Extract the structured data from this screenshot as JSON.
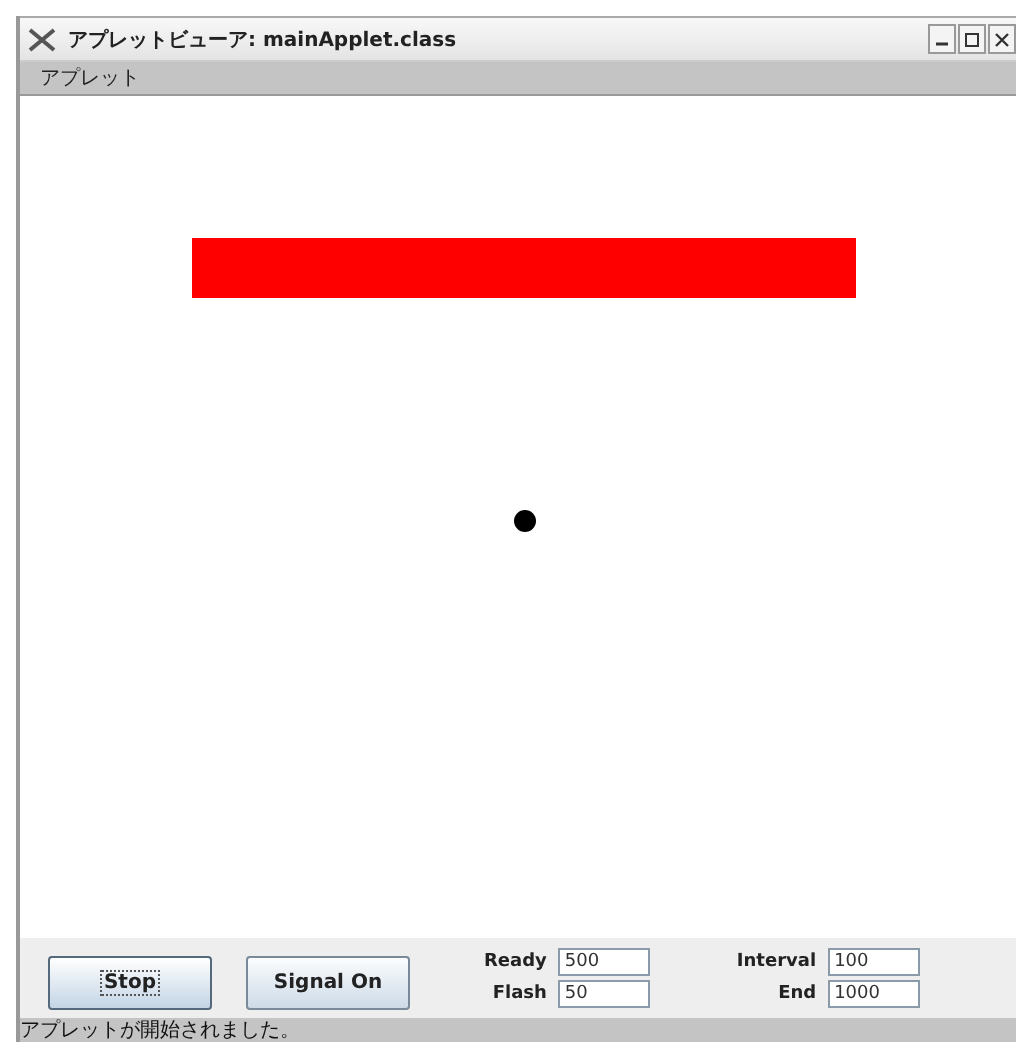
{
  "window": {
    "title": "アプレットビューア: mainApplet.class"
  },
  "menu": [
    "アプレット"
  ],
  "buttons": [
    {
      "label": "Stop",
      "focused": true
    },
    {
      "label": "Signal On",
      "focused": false
    }
  ],
  "fields": [
    {
      "label": "Ready",
      "value": "500"
    },
    {
      "label": "Flash",
      "value": "50"
    },
    {
      "label": "Interval",
      "value": "100"
    },
    {
      "label": "End",
      "value": "1000"
    }
  ],
  "status_bar": "アプレットが開始されました。"
}
